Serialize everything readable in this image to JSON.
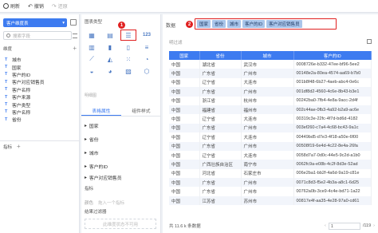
{
  "toolbar": {
    "refresh": "刷新",
    "undo": "撤销",
    "redo": "还原"
  },
  "left": {
    "dataset": "客户维度表",
    "search_placeholder": "搜索字段",
    "dimension_title": "维度",
    "dimensions": [
      "城市",
      "国家",
      "客户的ID",
      "客户对应销售员",
      "客户名称",
      "客户来源",
      "客户类型",
      "客户名称",
      "省份"
    ],
    "metric_title": "指标"
  },
  "mid": {
    "title": "图表类型",
    "badge": "1",
    "chart_types": [
      "table-icon",
      "cross-table-icon",
      "detail-table-icon",
      "number-card-icon",
      "bar-icon",
      "grouped-bar-icon",
      "stacked-bar-icon",
      "rank-icon",
      "line-icon",
      "area-icon",
      "scatter-icon",
      "gauge-icon",
      "combo-icon",
      "pie-icon",
      "map-icon",
      "map-point-icon"
    ],
    "more": "明细图",
    "tab_attr": "表格属性",
    "tab_style": "组件样式",
    "dims": [
      "国家",
      "省份",
      "城市",
      "客户的ID",
      "客户对应销售员"
    ],
    "metric_label": "指标",
    "color_label": "颜色",
    "color_placeholder": "拖入一个指标",
    "filter_label": "结果过滤器",
    "filter_hint": "此维度状态不可用"
  },
  "right": {
    "tab_label": "数据",
    "badge": "2",
    "tags": [
      "国家",
      "省份",
      "城市",
      "客户的ID",
      "客户对应销售员"
    ],
    "filter_link": "明过滤",
    "columns": [
      "国家",
      "省份",
      "城市",
      "客户的ID"
    ],
    "rows": [
      [
        "中国",
        "湖北省",
        "武汉市",
        "0008726e-b332-47ee-bf96-5ee2"
      ],
      [
        "中国",
        "广东省",
        "广州市",
        "00148e2a-80ea-4574-aa69-b7b0"
      ],
      [
        "中国",
        "辽宁省",
        "大连市",
        "001b8f48-6b27-4aeb-abc4-0e6c"
      ],
      [
        "中国",
        "广东省",
        "广州市",
        "001df8d2-4560-4c6e-8b43-b3e1"
      ],
      [
        "中国",
        "浙江省",
        "杭州市",
        "00242ba0-7fb4-4e8a-9acc-2d4f"
      ],
      [
        "中国",
        "福建省",
        "福州市",
        "002c44ae-0fb3-4a92-b2a9-ac6e"
      ],
      [
        "中国",
        "辽宁省",
        "大连市",
        "00319c3e-22fc-4f7d-bd6d-4182"
      ],
      [
        "中国",
        "广东省",
        "广州市",
        "003ef260-c7a4-4c68-bc43-9a1c"
      ],
      [
        "中国",
        "辽宁省",
        "大连市",
        "00449bd5-d7e3-4f18-a50e-6f00"
      ],
      [
        "中国",
        "广东省",
        "广州市",
        "00508f19-6e4d-4c22-8e4a-26fa"
      ],
      [
        "中国",
        "辽宁省",
        "大连市",
        "0058d7a7-0d0c-44e5-9c2d-a1b0"
      ],
      [
        "中国",
        "广西壮族自治区",
        "南宁市",
        "0062fc9a-e08b-4c2f-8d3e-52ad"
      ],
      [
        "中国",
        "河北省",
        "石家庄市",
        "006e2ba1-bb2f-4a6d-9a19-c81e"
      ],
      [
        "中国",
        "广东省",
        "广州市",
        "0071c8d3-f5e2-4b3a-a8c1-6d25"
      ],
      [
        "中国",
        "广东省",
        "广州市",
        "00762a0b-3ce9-4c4e-bd71-1a22"
      ],
      [
        "中国",
        "江苏省",
        "苏州市",
        "00817e4f-aa35-4e28-97a0-cd61"
      ]
    ],
    "summary": "共 11.6 k 条数据",
    "page": "1",
    "total_pages": "/119"
  }
}
